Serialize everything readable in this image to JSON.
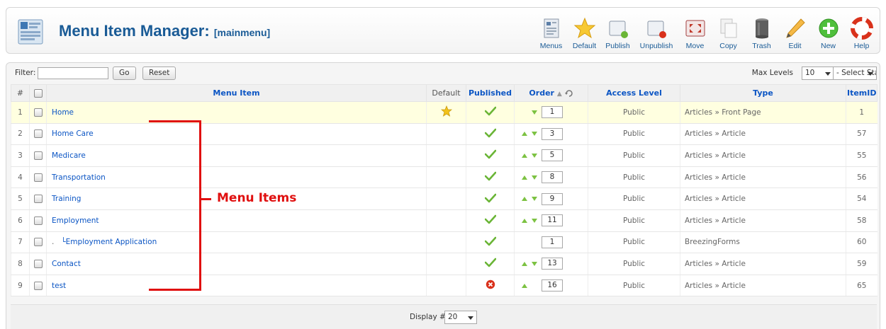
{
  "header": {
    "title": "Menu Item Manager:",
    "subtitle": "[mainmenu]"
  },
  "toolbar": [
    {
      "label": "Menus",
      "icon": "menus-icon"
    },
    {
      "label": "Default",
      "icon": "star-icon"
    },
    {
      "label": "Publish",
      "icon": "publish-icon"
    },
    {
      "label": "Unpublish",
      "icon": "unpublish-icon"
    },
    {
      "label": "Move",
      "icon": "move-icon"
    },
    {
      "label": "Copy",
      "icon": "copy-icon"
    },
    {
      "label": "Trash",
      "icon": "trash-icon"
    },
    {
      "label": "Edit",
      "icon": "edit-icon"
    },
    {
      "label": "New",
      "icon": "new-icon"
    },
    {
      "label": "Help",
      "icon": "help-icon"
    }
  ],
  "filter": {
    "label": "Filter:",
    "value": "",
    "go_label": "Go",
    "reset_label": "Reset",
    "max_levels_label": "Max Levels",
    "max_levels_value": "10",
    "state_value": "- Select State -"
  },
  "table": {
    "headers": {
      "num": "#",
      "menu_item": "Menu Item",
      "default": "Default",
      "published": "Published",
      "order": "Order",
      "access": "Access Level",
      "type": "Type",
      "itemid": "ItemID"
    },
    "rows": [
      {
        "num": "1",
        "name": "Home",
        "default": true,
        "published": true,
        "up": false,
        "down": true,
        "order": "1",
        "access": "Public",
        "type": "Articles » Front Page",
        "itemid": "1"
      },
      {
        "num": "2",
        "name": "Home Care",
        "default": false,
        "published": true,
        "up": true,
        "down": true,
        "order": "3",
        "access": "Public",
        "type": "Articles » Article",
        "itemid": "57"
      },
      {
        "num": "3",
        "name": "Medicare",
        "default": false,
        "published": true,
        "up": true,
        "down": true,
        "order": "5",
        "access": "Public",
        "type": "Articles » Article",
        "itemid": "55"
      },
      {
        "num": "4",
        "name": "Transportation",
        "default": false,
        "published": true,
        "up": true,
        "down": true,
        "order": "8",
        "access": "Public",
        "type": "Articles » Article",
        "itemid": "56"
      },
      {
        "num": "5",
        "name": "Training",
        "default": false,
        "published": true,
        "up": true,
        "down": true,
        "order": "9",
        "access": "Public",
        "type": "Articles » Article",
        "itemid": "54"
      },
      {
        "num": "6",
        "name": "Employment",
        "default": false,
        "published": true,
        "up": true,
        "down": true,
        "order": "11",
        "access": "Public",
        "type": "Articles » Article",
        "itemid": "58"
      },
      {
        "num": "7",
        "name": "Employment Application",
        "prefix": ".",
        "tree": "└",
        "default": false,
        "published": true,
        "up": false,
        "down": false,
        "order": "1",
        "access": "Public",
        "type": "BreezingForms",
        "itemid": "60"
      },
      {
        "num": "8",
        "name": "Contact",
        "default": false,
        "published": true,
        "up": true,
        "down": true,
        "order": "13",
        "access": "Public",
        "type": "Articles » Article",
        "itemid": "59"
      },
      {
        "num": "9",
        "name": "test",
        "default": false,
        "published": false,
        "up": true,
        "down": false,
        "order": "16",
        "access": "Public",
        "type": "Articles » Article",
        "itemid": "65"
      }
    ]
  },
  "footer": {
    "display_label": "Display #",
    "display_value": "20"
  },
  "annotation": {
    "label": "Menu Items",
    "color": "#e01010"
  },
  "colors": {
    "title": "#1a5b96",
    "link": "#0b55c4",
    "access": "#2c8a00",
    "highlight_row": "#ffffe0",
    "check": "#6ab536",
    "unpublished": "#d9311b",
    "default_star": "#f2c21b"
  }
}
